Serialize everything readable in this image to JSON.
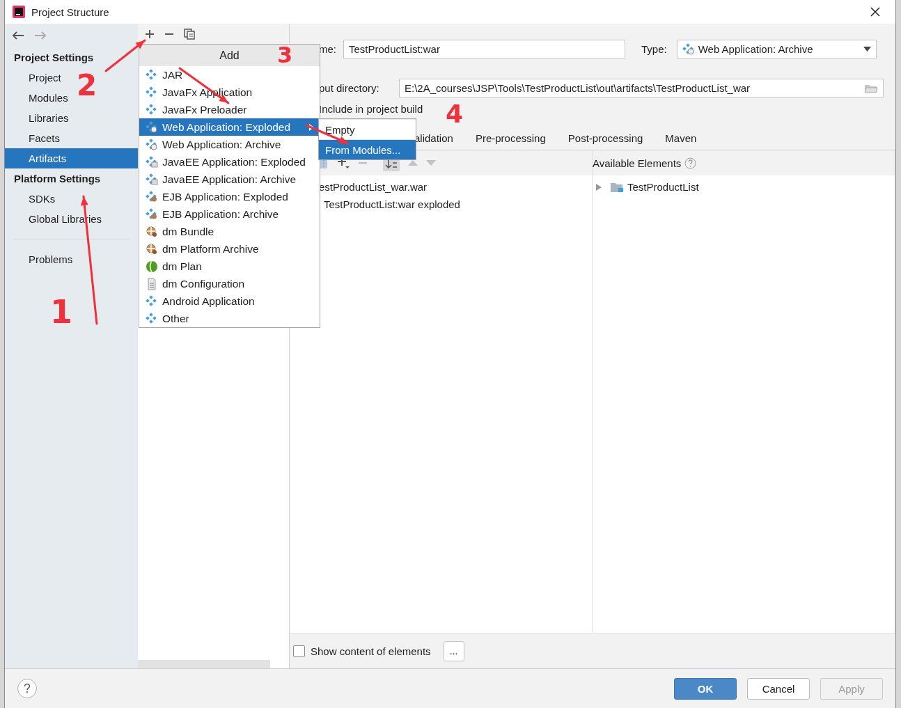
{
  "window": {
    "title": "Project Structure"
  },
  "sidebar": {
    "sections": [
      {
        "heading": "Project Settings",
        "items": [
          {
            "label": "Project",
            "selected": false
          },
          {
            "label": "Modules",
            "selected": false
          },
          {
            "label": "Libraries",
            "selected": false
          },
          {
            "label": "Facets",
            "selected": false
          },
          {
            "label": "Artifacts",
            "selected": true
          }
        ]
      },
      {
        "heading": "Platform Settings",
        "items": [
          {
            "label": "SDKs",
            "selected": false
          },
          {
            "label": "Global Libraries",
            "selected": false
          }
        ]
      },
      {
        "items": [
          {
            "label": "Problems",
            "selected": false
          }
        ]
      }
    ]
  },
  "add_menu": {
    "title": "Add",
    "items": [
      {
        "label": "JAR",
        "kind": "jar",
        "selected": false
      },
      {
        "label": "JavaFx Application",
        "kind": "jar",
        "selected": false
      },
      {
        "label": "JavaFx Preloader",
        "kind": "jar",
        "selected": false
      },
      {
        "label": "Web Application: Exploded",
        "kind": "web",
        "selected": true,
        "submenu": [
          {
            "label": "Empty",
            "selected": false
          },
          {
            "label": "From Modules...",
            "selected": true
          }
        ]
      },
      {
        "label": "Web Application: Archive",
        "kind": "web",
        "selected": false
      },
      {
        "label": "JavaEE Application: Exploded",
        "kind": "javaee",
        "selected": false
      },
      {
        "label": "JavaEE Application: Archive",
        "kind": "javaee",
        "selected": false
      },
      {
        "label": "EJB Application: Exploded",
        "kind": "ejb",
        "selected": false
      },
      {
        "label": "EJB Application: Archive",
        "kind": "ejb",
        "selected": false
      },
      {
        "label": "dm Bundle",
        "kind": "bundle",
        "selected": false
      },
      {
        "label": "dm Platform Archive",
        "kind": "bundle",
        "selected": false
      },
      {
        "label": "dm Plan",
        "kind": "plan",
        "selected": false
      },
      {
        "label": "dm Configuration",
        "kind": "config",
        "selected": false
      },
      {
        "label": "Android Application",
        "kind": "jar",
        "selected": false
      },
      {
        "label": "Other",
        "kind": "jar",
        "selected": false
      }
    ]
  },
  "artifact": {
    "name_label": "me:",
    "name": "TestProductList:war",
    "type_label": "Type:",
    "type": "Web Application: Archive",
    "output_label": "put directory:",
    "output": "E:\\2A_courses\\JSP\\Tools\\TestProductList\\out\\artifacts\\TestProductList_war",
    "include_label": "Include in project build"
  },
  "tabs": [
    {
      "label": "alidation",
      "selected": false
    },
    {
      "label": "Pre-processing",
      "selected": false
    },
    {
      "label": "Post-processing",
      "selected": false
    },
    {
      "label": "Maven",
      "selected": false
    }
  ],
  "output_tree": [
    {
      "label": "estProductList_war.war",
      "children": [
        {
          "label": "TestProductList:war exploded"
        }
      ]
    }
  ],
  "available": {
    "title": "Available Elements",
    "tree": [
      {
        "label": "TestProductList",
        "expanded": false
      }
    ]
  },
  "show_content": {
    "label": "Show content of elements",
    "checked": false
  },
  "more_button": "...",
  "buttons": [
    {
      "label": "OK",
      "kind": "primary"
    },
    {
      "label": "Cancel",
      "kind": "normal"
    },
    {
      "label": "Apply",
      "kind": "disabled"
    }
  ],
  "annotations": [
    {
      "label": "1"
    },
    {
      "label": "2"
    },
    {
      "label": "3"
    },
    {
      "label": "4"
    }
  ]
}
